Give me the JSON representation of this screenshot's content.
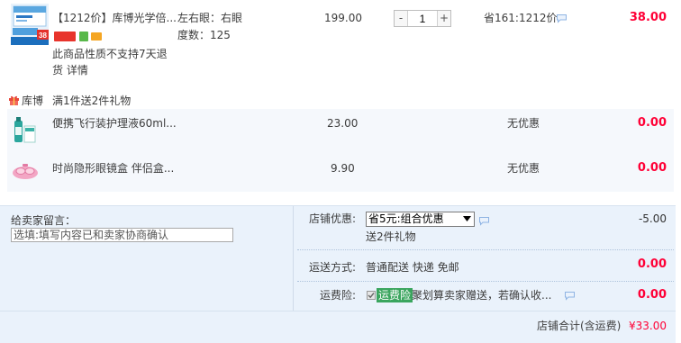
{
  "order_item": {
    "title": "【1212价】库博光学倍...",
    "thumbnail_tag": "38",
    "return_notice": "此商品性质不支持7天退货",
    "return_detail_link": "详情",
    "attributes": [
      "左右眼：右眼",
      "度数：125"
    ],
    "unit_price": "199.00",
    "quantity": "1",
    "minus_label": "-",
    "plus_label": "+",
    "discount": "省161:1212价",
    "subtotal": "38.00"
  },
  "gift_promo": {
    "shop": "库博",
    "label": "满1件送2件礼物"
  },
  "gift_items": [
    {
      "title": "便携飞行装护理液60ml...",
      "price": "23.00",
      "discount": "无优惠",
      "subtotal": "0.00"
    },
    {
      "title": "时尚隐形眼镜盒 伴侣盒...",
      "price": "9.90",
      "discount": "无优惠",
      "subtotal": "0.00"
    }
  ],
  "message": {
    "label": "给卖家留言：",
    "placeholder": "选填:填写内容已和卖家协商确认"
  },
  "shop_discount": {
    "label": "店铺优惠:",
    "selected": "省5元:组合优惠",
    "note": "送2件礼物",
    "amount": "-5.00"
  },
  "shipping": {
    "label": "运送方式:",
    "value": "普通配送 快递 免邮",
    "amount": "0.00"
  },
  "insurance": {
    "label": "运费险:",
    "checked": true,
    "tag": "运费险",
    "text": "聚划算卖家赠送，若确认收...",
    "amount": "0.00"
  },
  "total": {
    "label": "店铺合计(含运费)",
    "amount": "¥33.00"
  },
  "colors": {
    "price_red": "#ff0036",
    "text": "#3c3c3c",
    "panel_bg": "#eaf2fb",
    "tag_green": "#3aa55e"
  },
  "icons": {
    "gift": "gift-icon",
    "chat": "chat-bubble-icon",
    "dropdown": "chevron-down-icon",
    "check": "check-icon"
  }
}
